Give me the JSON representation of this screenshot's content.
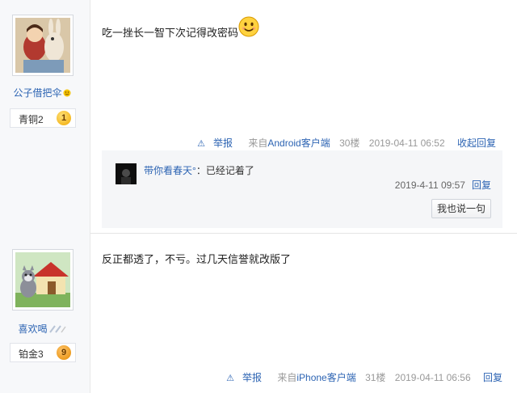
{
  "posts": [
    {
      "user": {
        "name": "公子借把伞",
        "avatar": "avatar-cartoon-couple",
        "level_name": "青铜2",
        "level_num": "1"
      },
      "content": "吃一挫长一智下次记得改密码",
      "emoji": "smile-emoji",
      "tail": {
        "report": "举报",
        "client_prefix": "来自",
        "client_name": "Android客户端",
        "floor": "30楼",
        "time": "2019-04-11 06:52",
        "action": "收起回复"
      },
      "replies": [
        {
          "user": "带你看春天°",
          "separator": "：",
          "text": "已经记着了",
          "time": "2019-4-11 09:57",
          "reply_label": "回复"
        }
      ],
      "say_button": "我也说一句"
    },
    {
      "user": {
        "name": "喜欢喝",
        "avatar": "avatar-tom-cat",
        "level_name": "铂金3",
        "level_num": "9"
      },
      "content": "反正都透了，不亏。过几天信誉就改版了",
      "tail": {
        "report": "举报",
        "client_prefix": "来自",
        "client_name": "iPhone客户端",
        "floor": "31楼",
        "time": "2019-04-11 06:56",
        "action": "回复"
      }
    }
  ],
  "colors": {
    "link": "#2d64b3",
    "sidebar_bg": "#f7f8fa",
    "reply_bg": "#f5f6f8",
    "muted": "#999999"
  }
}
